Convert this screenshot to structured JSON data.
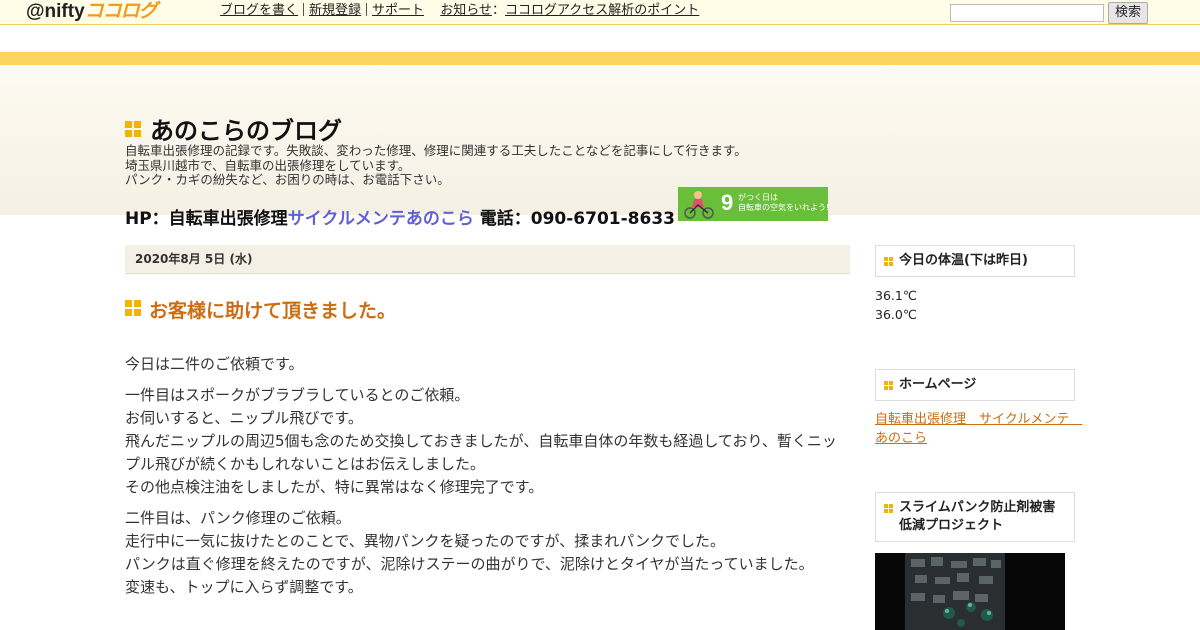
{
  "topbar": {
    "logo_at": "@nifty",
    "logo_coco": "ココログ",
    "nav": [
      "ブログを書く",
      "新規登録",
      "サポート"
    ],
    "notice_label": "お知らせ",
    "notice_colon": "：",
    "notice_link": "ココログアクセス解析のポイント",
    "search_placeholder": "",
    "search_button": "検索"
  },
  "header": {
    "title": "あのこらのブログ",
    "description": [
      "自転車出張修理の記録です。失敗談、変わった修理、修理に関連する工夫したことなどを記事にして行きます。",
      "埼玉県川越市で、自転車の出張修理をしています。",
      "パンク・カギの紛失など、お困りの時は、お電話下さい。"
    ],
    "hp_prefix": "HP：自転車出張修理",
    "hp_link": "サイクルメンテあのこら",
    "phone": " 電話：090-6701-8633",
    "banner_number": "9",
    "banner_line1": "がつく日は",
    "banner_line2": "自転車の空気をいれよう!"
  },
  "entry": {
    "date": "2020年8月 5日 (水)",
    "title": "お客様に助けて頂きました。",
    "paragraphs": [
      [
        "今日は二件のご依頼です。"
      ],
      [
        "一件目はスポークがブラブラしているとのご依頼。",
        "お伺いすると、ニップル飛びです。",
        "飛んだニップルの周辺5個も念のため交換しておきましたが、自転車自体の年数も経過しており、暫くニップル飛びが続くかもしれないことはお伝えしました。",
        "その他点検注油をしましたが、特に異常はなく修理完了です。"
      ],
      [
        "二件目は、パンク修理のご依頼。",
        "走行中に一気に抜けたとのことで、異物パンクを疑ったのですが、揉まれパンクでした。",
        "パンクは直ぐ修理を終えたのですが、泥除けステーの曲がりで、泥除けとタイヤが当たっていました。",
        "変速も、トップに入らず調整です。"
      ]
    ]
  },
  "sidebar": {
    "temp_title": "今日の体温(下は昨日)",
    "temp_today": "36.1℃",
    "temp_yesterday": "36.0℃",
    "home_title": "ホームページ",
    "home_link": "自転車出張修理　サイクルメンテ　あのこら",
    "slime_title": "スライムパンク防止剤被害低減プロジェクト"
  },
  "colors": {
    "accent_orange": "#cc6d12",
    "stripe_yellow": "#fcd55f",
    "link_blue": "#5f5fd6",
    "icon_yellow": "#f2b400"
  }
}
